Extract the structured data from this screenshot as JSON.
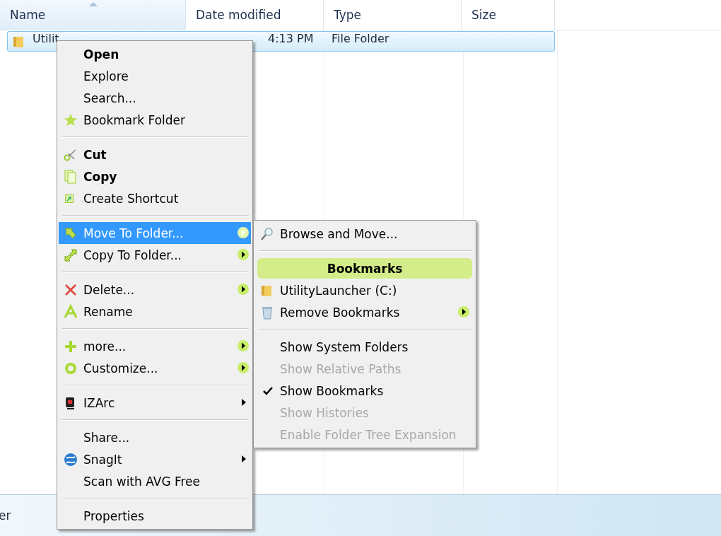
{
  "columns": [
    {
      "label": "Name",
      "sorted": true
    },
    {
      "label": "Date modified",
      "sorted": false
    },
    {
      "label": "Type",
      "sorted": false
    },
    {
      "label": "Size",
      "sorted": false
    }
  ],
  "rows": [
    {
      "name": "Utilit",
      "date": "4:13 PM",
      "type": "File Folder",
      "selected": true
    }
  ],
  "status_bar": {
    "text": "er"
  },
  "context_menu": {
    "items": [
      {
        "kind": "item",
        "label": "Open",
        "bold": true,
        "selected": false,
        "submenu": false
      },
      {
        "kind": "item",
        "label": "Explore",
        "bold": false,
        "selected": false,
        "submenu": false
      },
      {
        "kind": "item",
        "label": "Search...",
        "bold": false,
        "selected": false,
        "submenu": false
      },
      {
        "kind": "item",
        "label": "Bookmark Folder",
        "bold": false,
        "selected": false,
        "submenu": false
      },
      {
        "kind": "separator"
      },
      {
        "kind": "item",
        "label": "Cut",
        "bold": true,
        "selected": false,
        "submenu": false
      },
      {
        "kind": "item",
        "label": "Copy",
        "bold": true,
        "selected": false,
        "submenu": false
      },
      {
        "kind": "item",
        "label": "Create Shortcut",
        "bold": false,
        "selected": false,
        "submenu": false
      },
      {
        "kind": "separator"
      },
      {
        "kind": "item",
        "label": "Move To Folder...",
        "bold": false,
        "selected": true,
        "submenu": true
      },
      {
        "kind": "item",
        "label": "Copy To Folder...",
        "bold": false,
        "selected": false,
        "submenu": true
      },
      {
        "kind": "separator"
      },
      {
        "kind": "item",
        "label": "Delete...",
        "bold": false,
        "selected": false,
        "submenu": true
      },
      {
        "kind": "item",
        "label": "Rename",
        "bold": false,
        "selected": false,
        "submenu": false
      },
      {
        "kind": "separator"
      },
      {
        "kind": "item",
        "label": "more...",
        "bold": false,
        "selected": false,
        "submenu": true
      },
      {
        "kind": "item",
        "label": "Customize...",
        "bold": false,
        "selected": false,
        "submenu": true
      },
      {
        "kind": "separator"
      },
      {
        "kind": "item",
        "label": "IZArc",
        "bold": false,
        "selected": false,
        "submenu": true
      },
      {
        "kind": "separator"
      },
      {
        "kind": "item",
        "label": "Share...",
        "bold": false,
        "selected": false,
        "submenu": false
      },
      {
        "kind": "item",
        "label": "SnagIt",
        "bold": false,
        "selected": false,
        "submenu": true
      },
      {
        "kind": "item",
        "label": "Scan with AVG Free",
        "bold": false,
        "selected": false,
        "submenu": false
      },
      {
        "kind": "separator"
      },
      {
        "kind": "item",
        "label": "Properties",
        "bold": false,
        "selected": false,
        "submenu": false
      }
    ]
  },
  "submenu": {
    "items": [
      {
        "kind": "item",
        "label": "Browse and Move...",
        "disabled": false,
        "checked": false,
        "submenu": false
      },
      {
        "kind": "separator"
      },
      {
        "kind": "header",
        "label": "Bookmarks"
      },
      {
        "kind": "item",
        "label": "UtilityLauncher (C:)",
        "disabled": false,
        "checked": false,
        "submenu": false
      },
      {
        "kind": "item",
        "label": "Remove Bookmarks",
        "disabled": false,
        "checked": false,
        "submenu": true
      },
      {
        "kind": "separator"
      },
      {
        "kind": "item",
        "label": "Show System Folders",
        "disabled": false,
        "checked": false,
        "submenu": false
      },
      {
        "kind": "item",
        "label": "Show Relative Paths",
        "disabled": true,
        "checked": false,
        "submenu": false
      },
      {
        "kind": "item",
        "label": "Show Bookmarks",
        "disabled": false,
        "checked": true,
        "submenu": false
      },
      {
        "kind": "item",
        "label": "Show Histories",
        "disabled": true,
        "checked": false,
        "submenu": false
      },
      {
        "kind": "item",
        "label": "Enable Folder Tree Expansion",
        "disabled": true,
        "checked": false,
        "submenu": false
      }
    ]
  }
}
